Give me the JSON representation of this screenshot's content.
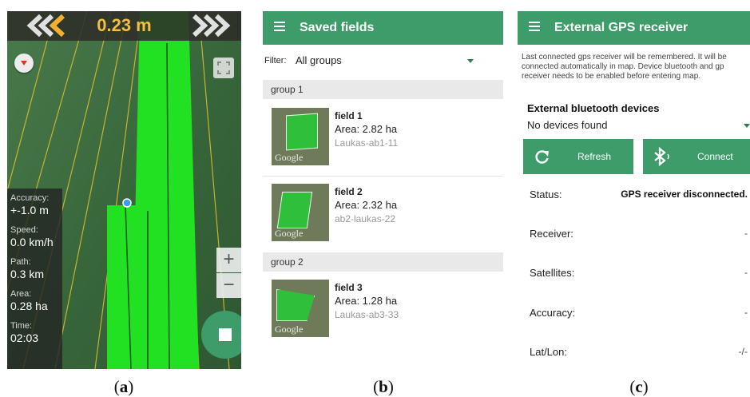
{
  "captions": {
    "a": "a",
    "b": "b",
    "c": "c"
  },
  "map_screen": {
    "distance": "0.23 m",
    "stats": [
      {
        "label": "Accuracy:",
        "value": "+-1.0 m"
      },
      {
        "label": "Speed:",
        "value": "0.0 km/h"
      },
      {
        "label": "Path:",
        "value": "0.3 km"
      },
      {
        "label": "Area:",
        "value": "0.28 ha"
      },
      {
        "label": "Time:",
        "value": "02:03"
      }
    ],
    "zoom_in": "+",
    "zoom_out": "−",
    "colors": {
      "coverage": "#22e022",
      "field": "#3b6e3f",
      "guide_line": "#e0c030",
      "fab": "#3d9c6a"
    },
    "icons": [
      "chevrons-left-icon",
      "chevrons-right-icon",
      "compass-icon",
      "expand-icon",
      "stop-icon"
    ]
  },
  "saved_fields": {
    "title": "Saved fields",
    "filter_label": "Filter:",
    "filter_value": "All groups",
    "groups": [
      {
        "name": "group 1"
      },
      {
        "name": "group 2"
      }
    ],
    "fields": [
      {
        "name": "field 1",
        "area": "Area: 2.82 ha",
        "id": "Laukas-ab1-11",
        "thumb_text": "Google"
      },
      {
        "name": "field 2",
        "area": "Area: 2.32 ha",
        "id": "ab2-laukas-22",
        "thumb_text": "Google"
      },
      {
        "name": "field 3",
        "area": "Area: 1.28 ha",
        "id": "Laukas-ab3-33",
        "thumb_text": "Google"
      }
    ],
    "colors": {
      "appbar": "#3d9c6a",
      "group_header": "#e9e9e9"
    },
    "icons": [
      "menu-icon",
      "dropdown-arrow-icon"
    ]
  },
  "gps_receiver": {
    "title": "External GPS receiver",
    "description": [
      "Last connected gps receiver will be remembered. It will be",
      "connected automatically in map. Device bluetooth and gp",
      "receiver needs to be enabled before entering map."
    ],
    "bt_title": "External bluetooth devices",
    "bt_value": "No devices found",
    "refresh_label": "Refresh",
    "connect_label": "Connect",
    "rows": [
      {
        "label": "Status:",
        "value": "GPS receiver disconnected."
      },
      {
        "label": "Receiver:",
        "value": "-"
      },
      {
        "label": "Satellites:",
        "value": "-"
      },
      {
        "label": "Accuracy:",
        "value": "-"
      },
      {
        "label": "Lat/Lon:",
        "value": "-/-"
      }
    ],
    "icons": [
      "menu-icon",
      "dropdown-arrow-icon",
      "refresh-icon",
      "bluetooth-icon"
    ]
  }
}
